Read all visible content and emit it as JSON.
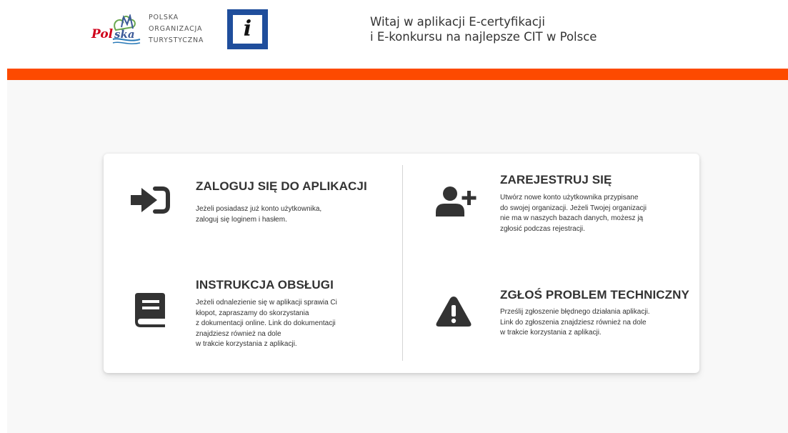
{
  "header": {
    "org_logo_text": [
      "POLSKA",
      "ORGANIZACJA",
      "TURYSTYCZNA"
    ],
    "polska_logo_text": "Polska",
    "info_logo_glyph": "i",
    "title_line1": "Witaj w aplikacji E-certyfikacji",
    "title_line2": "i E-konkursu na najlepsze CIT w Polsce"
  },
  "colors": {
    "accent_bar": "#fd4a00",
    "icon": "#333333",
    "info_logo_frame": "#1f4e9c",
    "background": "#f8f8f8"
  },
  "options": {
    "login": {
      "icon": "sign-in-icon",
      "title": "ZALOGUJ SIĘ DO APLIKACJI",
      "description": "Jeżeli posiadasz już konto użytkownika,\nzaloguj się loginem i hasłem."
    },
    "register": {
      "icon": "user-plus-icon",
      "title": "ZAREJESTRUJ SIĘ",
      "description": "Utwórz nowe konto użytkownika przypisane\ndo swojej organizacji. Jeżeli Twojej organizacji\nnie ma w naszych bazach danych, możesz ją\nzgłosić podczas rejestracji."
    },
    "manual": {
      "icon": "book-icon",
      "title": "INSTRUKCJA OBSŁUGI",
      "description": "Jeżeli odnalezienie się w aplikacji sprawia Ci\nkłopot, zapraszamy do skorzystania\nz dokumentacji online. Link do dokumentacji\nznajdziesz również na dole\nw trakcie korzystania z aplikacji."
    },
    "problem": {
      "icon": "warning-icon",
      "title": "ZGŁOŚ PROBLEM TECHNICZNY",
      "description": "Prześlij zgłoszenie błędnego działania aplikacji.\nLink do zgłoszenia znajdziesz również na dole\nw trakcie korzystania z aplikacji."
    }
  }
}
